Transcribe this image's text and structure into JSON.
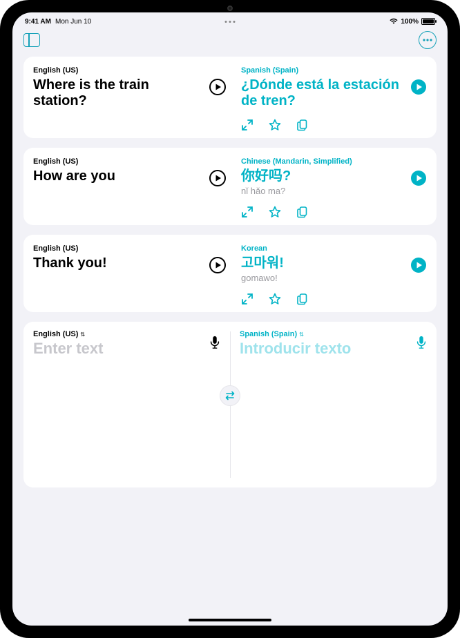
{
  "status": {
    "time": "9:41 AM",
    "date": "Mon Jun 10",
    "battery": "100%"
  },
  "accent": "#00b3c6",
  "cards": [
    {
      "src_lang": "English (US)",
      "src_text": "Where is the train station?",
      "dst_lang": "Spanish (Spain)",
      "dst_text": "¿Dónde está la estación de tren?",
      "roman": ""
    },
    {
      "src_lang": "English (US)",
      "src_text": "How are you",
      "dst_lang": "Chinese (Mandarin, Simplified)",
      "dst_text": "你好吗?",
      "roman": "nǐ hǎo ma?"
    },
    {
      "src_lang": "English (US)",
      "src_text": "Thank you!",
      "dst_lang": "Korean",
      "dst_text": "고마워!",
      "roman": "gomawo!"
    }
  ],
  "input": {
    "src_lang": "English (US)",
    "src_placeholder": "Enter text",
    "dst_lang": "Spanish (Spain)",
    "dst_placeholder": "Introducir texto"
  }
}
